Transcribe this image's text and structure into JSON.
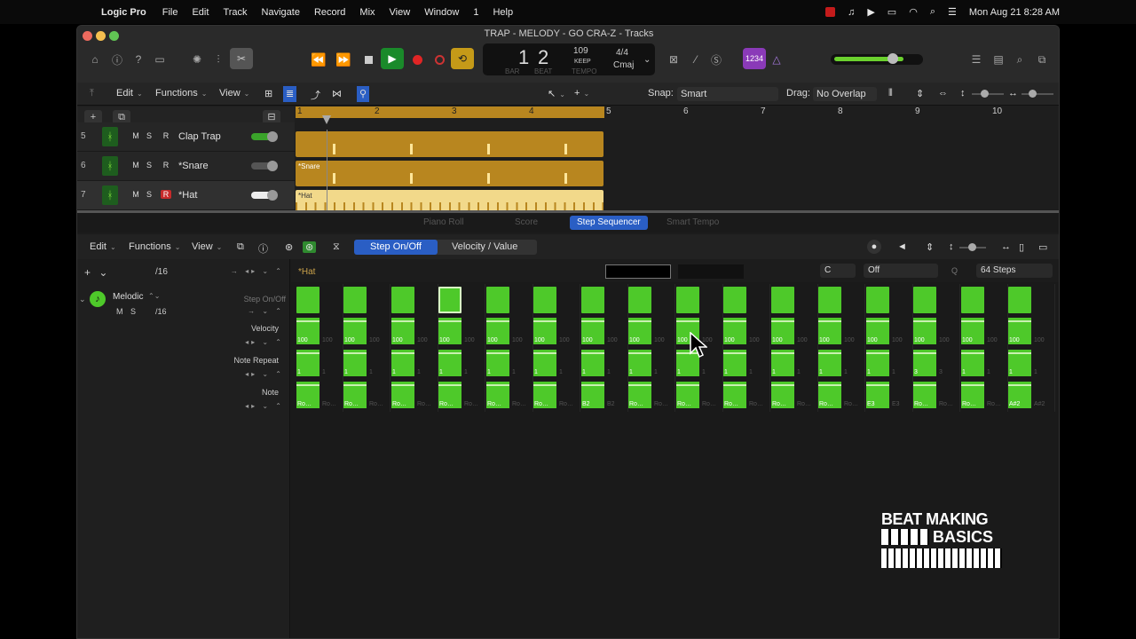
{
  "menubar": {
    "app": "Logic Pro",
    "items": [
      "File",
      "Edit",
      "Track",
      "Navigate",
      "Record",
      "Mix",
      "View",
      "Window",
      "1",
      "Help"
    ],
    "clock": "Mon Aug 21  8:28 AM"
  },
  "window": {
    "title": "TRAP - MELODY - GO CRA-Z - Tracks"
  },
  "lcd": {
    "bar": "1",
    "beat": "2",
    "tempo": "109",
    "keep": "KEEP",
    "time_sig": "4/4",
    "key": "Cmaj",
    "bar_lbl": "BAR",
    "beat_lbl": "BEAT",
    "tempo_lbl": "TEMPO",
    "badge": "1234"
  },
  "tracks_toolbar": {
    "edit": "Edit",
    "functions": "Functions",
    "view": "View",
    "snap_label": "Snap:",
    "snap_value": "Smart",
    "drag_label": "Drag:",
    "drag_value": "No Overlap"
  },
  "ruler": [
    "1",
    "2",
    "3",
    "4",
    "5",
    "6",
    "7",
    "8",
    "9",
    "10"
  ],
  "tracks": [
    {
      "num": "5",
      "name": "Clap Trap",
      "m": "M",
      "s": "S",
      "r": "R"
    },
    {
      "num": "6",
      "name": "*Snare",
      "m": "M",
      "s": "S",
      "r": "R"
    },
    {
      "num": "7",
      "name": "*Hat",
      "m": "M",
      "s": "S",
      "r": "R"
    }
  ],
  "regions": {
    "snare": "*Snare",
    "hat": "*Hat"
  },
  "editor": {
    "tabs": [
      "Piano Roll",
      "Score",
      "Step Sequencer",
      "Smart Tempo"
    ],
    "active_tab": "Step Sequencer",
    "edit": "Edit",
    "functions": "Functions",
    "view": "View",
    "mode_on": "Step On/Off",
    "mode_value": "Velocity / Value",
    "pattern_name": "*Hat",
    "key": "C",
    "scale": "Off",
    "steps": "64 Steps",
    "left": {
      "rate": "/16",
      "row_name": "Melodic",
      "row_rate": "/16",
      "m": "M",
      "s": "S",
      "step_onoff": "Step On/Off",
      "velocity": "Velocity",
      "note_repeat": "Note Repeat",
      "note": "Note"
    },
    "velocity_values": [
      "100",
      "100",
      "100",
      "100",
      "100",
      "100",
      "100",
      "100",
      "100",
      "100",
      "100",
      "100",
      "100",
      "100",
      "100",
      "100"
    ],
    "note_repeat_values": [
      "1",
      "1",
      "1",
      "1",
      "1",
      "1",
      "1",
      "1",
      "1",
      "1",
      "1",
      "1",
      "1",
      "3",
      "1",
      "1"
    ],
    "note_values": [
      "Ro…",
      "Ro…",
      "Ro…",
      "Ro…",
      "Ro…",
      "Ro…",
      "B2",
      "Ro…",
      "Ro…",
      "Ro…",
      "Ro…",
      "Ro…",
      "E3",
      "Ro…",
      "Ro…",
      "A#2"
    ]
  },
  "watermark": {
    "line1": "BEAT MAKING",
    "line2": "BASICS"
  }
}
